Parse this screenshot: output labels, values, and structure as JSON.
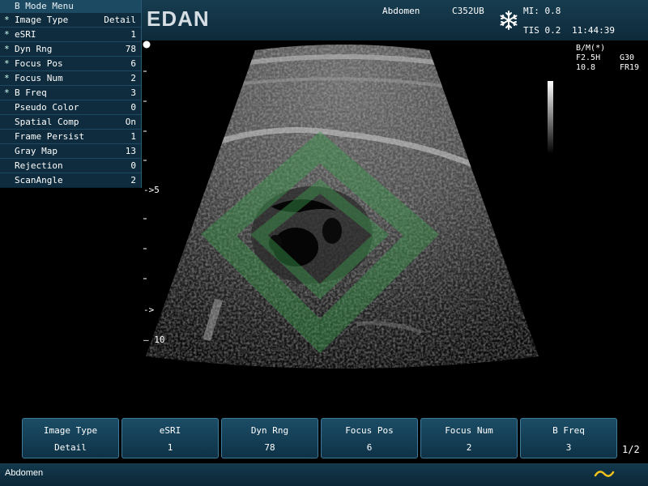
{
  "menu": {
    "title": "B Mode Menu",
    "items": [
      {
        "star": "*",
        "label": "Image Type",
        "value": "Detail"
      },
      {
        "star": "*",
        "label": "eSRI",
        "value": "1"
      },
      {
        "star": "*",
        "label": "Dyn Rng",
        "value": "78"
      },
      {
        "star": "*",
        "label": "Focus Pos",
        "value": "6"
      },
      {
        "star": "*",
        "label": "Focus Num",
        "value": "2"
      },
      {
        "star": "*",
        "label": "B Freq",
        "value": "3"
      },
      {
        "star": "",
        "label": "Pseudo Color",
        "value": "0"
      },
      {
        "star": "",
        "label": "Spatial Comp",
        "value": "On"
      },
      {
        "star": "",
        "label": "Frame Persist",
        "value": "1"
      },
      {
        "star": "",
        "label": "Gray Map",
        "value": "13"
      },
      {
        "star": "",
        "label": "Rejection",
        "value": "0"
      },
      {
        "star": "",
        "label": "ScanAngle",
        "value": "2"
      }
    ]
  },
  "header": {
    "brand": "EDAN",
    "exam": "Abdomen",
    "probe": "C352UB",
    "mi": "MI: 0.8",
    "tis": "TIS 0.2",
    "time": "11:44:39"
  },
  "params": {
    "mode": "B/M(*)",
    "freq": "F2.5H",
    "gain": "G30",
    "depth": "10.8",
    "framerate": "FR19"
  },
  "depth_scale": {
    "mark_5": "5",
    "mark_10": "10",
    "focus_marker": "->"
  },
  "softkeys": [
    {
      "label": "Image Type",
      "value": "Detail"
    },
    {
      "label": "eSRI",
      "value": "1"
    },
    {
      "label": "Dyn Rng",
      "value": "78"
    },
    {
      "label": "Focus Pos",
      "value": "6"
    },
    {
      "label": "Focus Num",
      "value": "2"
    },
    {
      "label": "B Freq",
      "value": "3"
    }
  ],
  "page_indicator": "1/2",
  "status": {
    "text": "Abdomen"
  },
  "icons": {
    "freeze": "snowflake-icon",
    "wave": "wave-icon",
    "orientation": "orientation-dot-icon"
  },
  "colors": {
    "accent": "#1c4a62",
    "wave_icon": "#f2c21b"
  }
}
